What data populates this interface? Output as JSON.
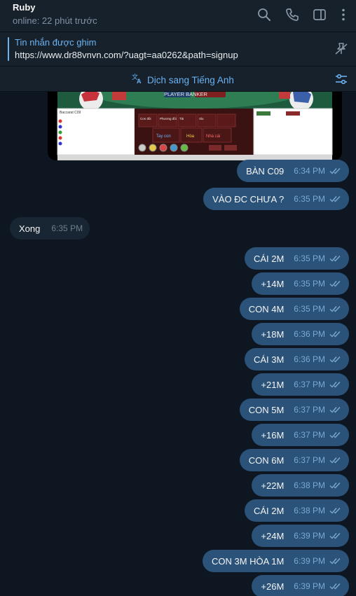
{
  "header": {
    "name": "Ruby",
    "status": "online: 22 phút trước",
    "icons": [
      "search-icon",
      "phone-icon",
      "sidebar-icon",
      "more-vertical-icon"
    ]
  },
  "pinned": {
    "title": "Tin nhắn được ghim",
    "url": "https://www.dr88vnvn.com/?uagt=aa0262&path=signup"
  },
  "translate": {
    "label": "Dịch sang Tiếng Anh"
  },
  "image_caption": {
    "player_banker": "PLAYER BANKER",
    "table": "Baccarat C09",
    "bets": [
      "Con đôi",
      "Phương đôi",
      "Tài",
      "Xỉu",
      "Tay con",
      "Hòa",
      "Nhà cái"
    ]
  },
  "messages": [
    {
      "dir": "out",
      "text": "BÀN C09",
      "time": "6:34 PM"
    },
    {
      "dir": "out",
      "text": "VÀO ĐC CHƯA ?",
      "time": "6:35 PM"
    },
    {
      "dir": "in",
      "text": "Xong",
      "time": "6:35 PM"
    },
    {
      "dir": "out",
      "text": "CÁI 2M",
      "time": "6:35 PM"
    },
    {
      "dir": "out",
      "text": "+14M",
      "time": "6:35 PM"
    },
    {
      "dir": "out",
      "text": "CON 4M",
      "time": "6:35 PM"
    },
    {
      "dir": "out",
      "text": "+18M",
      "time": "6:36 PM"
    },
    {
      "dir": "out",
      "text": "CÁI 3M",
      "time": "6:36 PM"
    },
    {
      "dir": "out",
      "text": "+21M",
      "time": "6:37 PM"
    },
    {
      "dir": "out",
      "text": "CON 5M",
      "time": "6:37 PM"
    },
    {
      "dir": "out",
      "text": "+16M",
      "time": "6:37 PM"
    },
    {
      "dir": "out",
      "text": "CON 6M",
      "time": "6:37 PM"
    },
    {
      "dir": "out",
      "text": "+22M",
      "time": "6:38 PM"
    },
    {
      "dir": "out",
      "text": "CÁI 2M",
      "time": "6:38 PM"
    },
    {
      "dir": "out",
      "text": "+24M",
      "time": "6:39 PM"
    },
    {
      "dir": "out",
      "text": "CON 3M HÒA 1M",
      "time": "6:39 PM"
    },
    {
      "dir": "out",
      "text": "+26M",
      "time": "6:39 PM"
    }
  ],
  "colors": {
    "background": "#0e1621",
    "panel": "#17212b",
    "outgoing_bubble": "#2b5278",
    "incoming_bubble": "#182533",
    "accent": "#6ab2f2"
  }
}
